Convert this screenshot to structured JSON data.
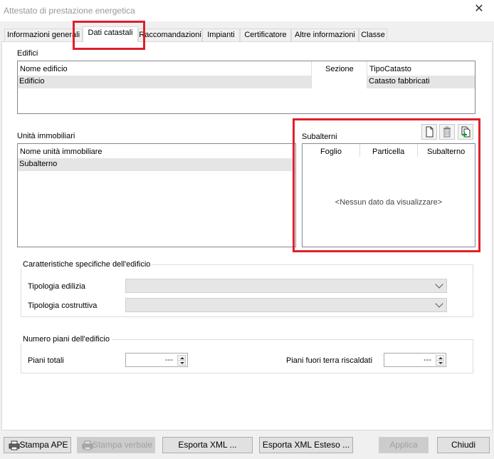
{
  "window": {
    "title": "Attestato di prestazione energetica",
    "close_symbol": "✕"
  },
  "tabs": [
    {
      "label": "Informazioni generali"
    },
    {
      "label": "Dati catastali"
    },
    {
      "label": "Raccomandazioni"
    },
    {
      "label": "Impianti"
    },
    {
      "label": "Certificatore"
    },
    {
      "label": "Altre informazioni"
    },
    {
      "label": "Classe"
    }
  ],
  "edifici": {
    "label": "Edifici",
    "columns": [
      "Nome edificio",
      "Sezione",
      "TipoCatasto"
    ],
    "rows": [
      {
        "nome": "Edificio",
        "sezione": "",
        "tipo": "Catasto fabbricati"
      }
    ]
  },
  "unita": {
    "label": "Unità immobiliari",
    "column": "Nome unità immobiliare",
    "rows": [
      "Subalterno"
    ]
  },
  "subalterni": {
    "label": "Subalterni",
    "columns": [
      "Foglio",
      "Particella",
      "Subalterno"
    ],
    "empty_text": "<Nessun dato da visualizzare>",
    "toolbar": {
      "new_icon": "new-document-icon",
      "delete_icon": "trash-icon",
      "add_icon": "add-copy-icon"
    }
  },
  "caratteristiche": {
    "title": "Caratteristiche specifiche dell'edificio",
    "tipologia_edilizia_label": "Tipologia edilizia",
    "tipologia_edilizia_value": "",
    "tipologia_costruttiva_label": "Tipologia costruttiva",
    "tipologia_costruttiva_value": ""
  },
  "piani": {
    "title": "Numero piani dell'edificio",
    "totali_label": "Piani totali",
    "totali_value": "---",
    "fuori_terra_label": "Piani fuori terra riscaldati",
    "fuori_terra_value": "---"
  },
  "buttons": {
    "stampa_ape": "Stampa APE",
    "stampa_verbale": "Stampa verbale",
    "esporta_xml": "Esporta XML ...",
    "esporta_xml_esteso": "Esporta XML Esteso ...",
    "applica": "Applica",
    "chiudi": "Chiudi"
  },
  "colors": {
    "highlight": "#e0202a",
    "selected_row": "#e5e5e5"
  }
}
